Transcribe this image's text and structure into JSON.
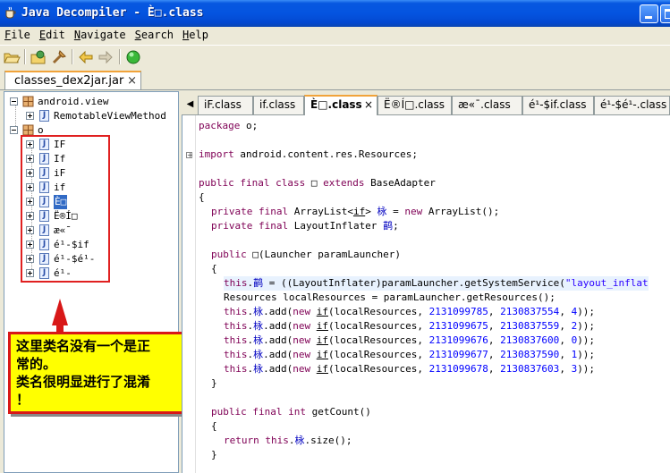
{
  "window": {
    "title": "Java Decompiler - È□.class"
  },
  "menu": [
    {
      "label": "File",
      "mnemonic": "F",
      "rest": "ile"
    },
    {
      "label": "Edit",
      "mnemonic": "E",
      "rest": "dit"
    },
    {
      "label": "Navigate",
      "mnemonic": "N",
      "rest": "avigate"
    },
    {
      "label": "Search",
      "mnemonic": "S",
      "rest": "earch"
    },
    {
      "label": "Help",
      "mnemonic": "H",
      "rest": "elp"
    }
  ],
  "toolbar": {
    "icons": [
      "open-file-icon",
      "open-type-icon",
      "search-icon",
      "back-arrow-icon",
      "forward-arrow-icon",
      "run-icon"
    ]
  },
  "outer_tab": {
    "label": "classes_dex2jar.jar",
    "close": "×"
  },
  "tree": {
    "packages": [
      {
        "name": "android.view",
        "classes": [
          "RemotableViewMethod"
        ]
      },
      {
        "name": "o",
        "classes": [
          "IF",
          "If",
          "iF",
          "if",
          "È□",
          "Ë®Í□",
          "æ«¯",
          "é¹-$if",
          "é¹-$é¹-",
          "é¹-"
        ]
      }
    ],
    "selected": "È□"
  },
  "annotation": {
    "line1": "这里类名没有一个是正",
    "line2": "常的。",
    "line3": "类名很明显进行了混淆",
    "line4": "！"
  },
  "editor_tabs": [
    {
      "label": "iF.class"
    },
    {
      "label": "if.class"
    },
    {
      "label": "È□.class",
      "active": true,
      "close": "×"
    },
    {
      "label": "Ë®Í□.class"
    },
    {
      "label": "æ«¯.class"
    },
    {
      "label": "é¹-$if.class"
    },
    {
      "label": "é¹-$é¹-.class"
    }
  ],
  "code": {
    "package_kw": "package",
    "package_name": " o;",
    "import_kw": "import",
    "import_name": " android.content.res.Resources;",
    "class_decl": {
      "mods": "public final class",
      "name": " □ ",
      "extends_kw": "extends",
      "parent": " BaseAdapter"
    },
    "brace_open": "{",
    "field1": {
      "mods": "private final",
      "type": " ArrayList<",
      "generic": "if",
      "type_end": "> ",
      "name": "栐",
      "eq": " = ",
      "new_kw": "new",
      "ctor": " ArrayList();"
    },
    "field2": {
      "mods": "private final",
      "type": " LayoutInflater ",
      "name": "鹋",
      "end": ";"
    },
    "ctor_sig": {
      "mods": "public",
      "sig": " □(Launcher paramLauncher)"
    },
    "ctor_open": "{",
    "stmt_this": "this",
    "stmt_inflater_name": "鹋",
    "stmt_inflater_rest": " = ((LayoutInflater)paramLauncher.getSystemService(",
    "stmt_inflater_str": "\"layout_inflat",
    "stmt_resources": "Resources localResources = paramLauncher.getResources();",
    "adds": [
      {
        "a": "2131099785",
        "b": "2130837554",
        "c": "4"
      },
      {
        "a": "2131099675",
        "b": "2130837559",
        "c": "2"
      },
      {
        "a": "2131099676",
        "b": "2130837600",
        "c": "0"
      },
      {
        "a": "2131099677",
        "b": "2130837590",
        "c": "1"
      },
      {
        "a": "2131099678",
        "b": "2130837603",
        "c": "3"
      }
    ],
    "add_field": "栐",
    "add_mid": ".add(",
    "add_new": "new",
    "add_type": "if",
    "add_args_open": "(localResources, ",
    "ctor_close": "}",
    "count_sig": {
      "mods": "public final int",
      "sig": " getCount()"
    },
    "count_open": "{",
    "count_return": "return",
    "count_field": "栐",
    "count_end": ".size();",
    "count_close": "}"
  }
}
